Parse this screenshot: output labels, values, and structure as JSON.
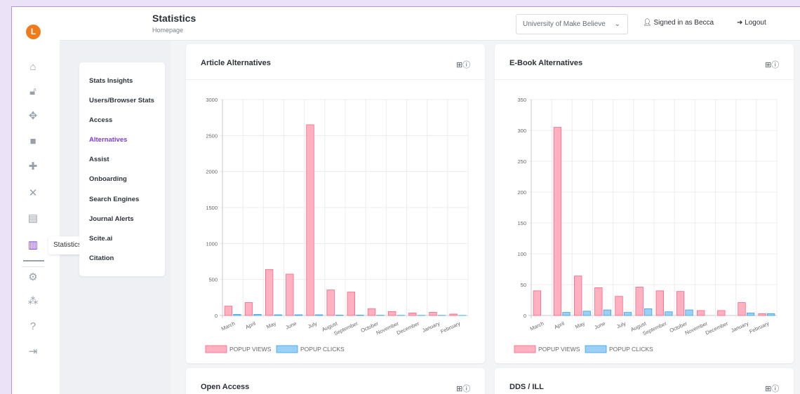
{
  "rail": {
    "logo_letter": "L",
    "icons": [
      "home-icon",
      "unlock-icon",
      "move-arrows-icon",
      "comment-icon",
      "puzzle-icon",
      "tools-icon",
      "stack-icon",
      "bar-chart-icon",
      "gear-icon",
      "users-icon",
      "help-icon",
      "sign-in-icon"
    ],
    "tooltip": "Statistics"
  },
  "header": {
    "title": "Statistics",
    "subtitle": "Homepage",
    "institution": "University of Make Believe",
    "signed_in": "Signed in as Becca",
    "logout": "Logout"
  },
  "submenu": {
    "items": [
      "Stats Insights",
      "Users/Browser Stats",
      "Access",
      "Alternatives",
      "Assist",
      "Onboarding",
      "Search Engines",
      "Journal Alerts",
      "Scite.ai",
      "Citation"
    ],
    "active": "Alternatives"
  },
  "cards": {
    "article": {
      "title": "Article Alternatives"
    },
    "ebook": {
      "title": "E-Book Alternatives"
    },
    "openaccess": {
      "title": "Open Access"
    },
    "dds": {
      "title": "DDS / ILL"
    }
  },
  "colors": {
    "accent": "#7c3aed",
    "views_fill": "#ffb1c1",
    "views_stroke": "#ff6384",
    "clicks_fill": "#9ad0f5",
    "clicks_stroke": "#36a2eb"
  },
  "chart_data": [
    {
      "type": "bar",
      "title": "Article Alternatives",
      "categories": [
        "March",
        "April",
        "May",
        "June",
        "July",
        "August",
        "September",
        "October",
        "November",
        "December",
        "January",
        "February"
      ],
      "series": [
        {
          "name": "POPUP VIEWS",
          "values": [
            130,
            180,
            640,
            575,
            2650,
            355,
            325,
            95,
            55,
            35,
            45,
            20
          ]
        },
        {
          "name": "POPUP CLICKS",
          "values": [
            15,
            15,
            10,
            10,
            10,
            5,
            5,
            3,
            2,
            2,
            2,
            1
          ]
        }
      ],
      "yticks": [
        0,
        500,
        1000,
        1500,
        2000,
        2500,
        3000
      ],
      "ylim": [
        0,
        3000
      ]
    },
    {
      "type": "bar",
      "title": "E-Book Alternatives",
      "categories": [
        "March",
        "April",
        "May",
        "June",
        "July",
        "August",
        "September",
        "October",
        "November",
        "December",
        "January",
        "February"
      ],
      "series": [
        {
          "name": "POPUP VIEWS",
          "values": [
            40,
            305,
            64,
            45,
            31,
            46,
            40,
            39,
            8,
            8,
            21,
            3
          ]
        },
        {
          "name": "POPUP CLICKS",
          "values": [
            0,
            5,
            7,
            9,
            5,
            11,
            6,
            9,
            0,
            0,
            4,
            3
          ]
        }
      ],
      "yticks": [
        0,
        50,
        100,
        150,
        200,
        250,
        300,
        350
      ],
      "ylim": [
        0,
        350
      ]
    }
  ]
}
